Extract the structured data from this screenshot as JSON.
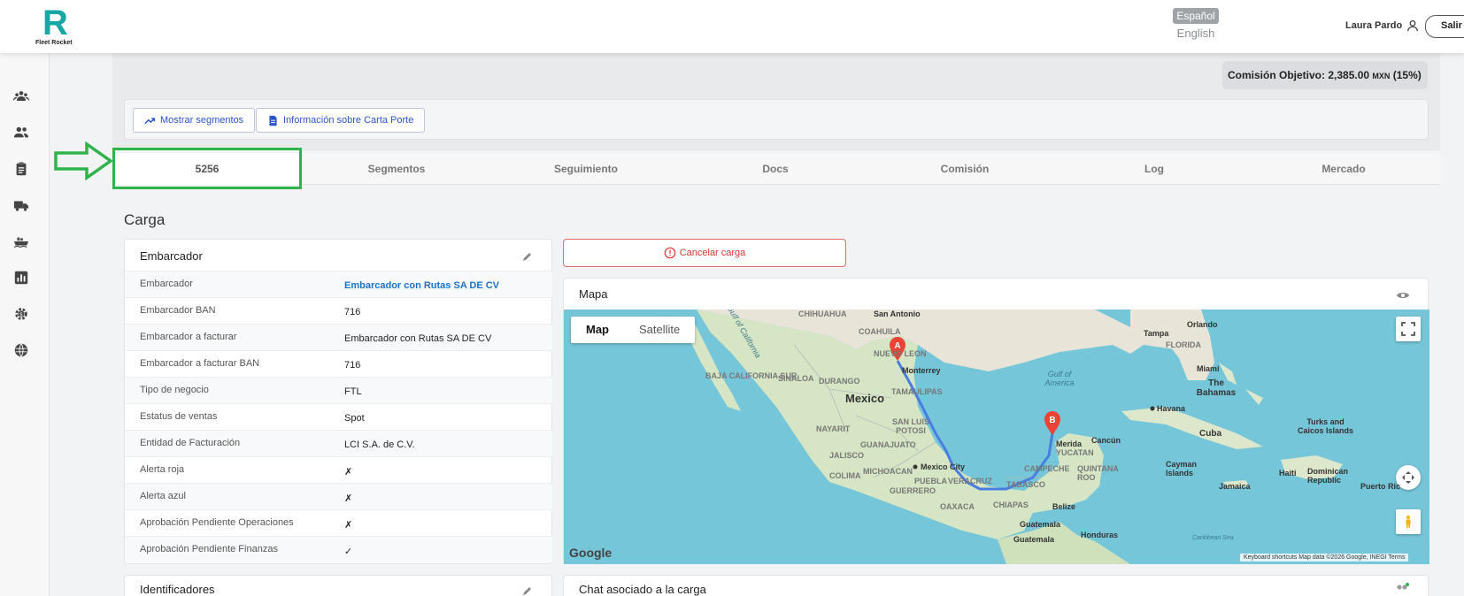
{
  "header": {
    "logo_text": "Fleet Rocket",
    "lang_active": "Español",
    "lang_other": "English",
    "user_name": "Laura Pardo",
    "logout_label": "Salir"
  },
  "sidebar": {
    "icons": [
      "groups-icon",
      "people-icon",
      "clipboard-icon",
      "truck-icon",
      "ship-icon",
      "chart-icon",
      "settings-money-icon",
      "globe-icon"
    ]
  },
  "summary": {
    "commission_label": "Comisión Objetivo: 2,385.00",
    "commission_currency": "MXN",
    "commission_pct": "(15%)"
  },
  "actions": {
    "show_segments": "Mostrar segmentos",
    "carta_porte": "Información sobre Carta Porte"
  },
  "tabs": [
    "5256",
    "Segmentos",
    "Seguimiento",
    "Docs",
    "Comisión",
    "Log",
    "Mercado"
  ],
  "section_title": "Carga",
  "shipper": {
    "title": "Embarcador",
    "rows": [
      {
        "label": "Embarcador",
        "value": "Embarcador con Rutas SA DE CV"
      },
      {
        "label": "Embarcador BAN",
        "value": "716"
      },
      {
        "label": "Embarcador a facturar",
        "value": "Embarcador con Rutas SA DE CV"
      },
      {
        "label": "Embarcador a facturar BAN",
        "value": "716"
      },
      {
        "label": "Tipo de negocio",
        "value": "FTL"
      },
      {
        "label": "Estatus de ventas",
        "value": "Spot"
      },
      {
        "label": "Entidad de Facturación",
        "value": "LCI S.A. de C.V."
      },
      {
        "label": "Alerta roja",
        "value": "✗"
      },
      {
        "label": "Alerta azul",
        "value": "✗"
      },
      {
        "label": "Aprobación Pendiente Operaciones",
        "value": "✗"
      },
      {
        "label": "Aprobación Pendiente Finanzas",
        "value": "✓"
      }
    ]
  },
  "cancel_label": "Cancelar carga",
  "map": {
    "title": "Mapa",
    "toggle_map": "Map",
    "toggle_satellite": "Satellite",
    "marker_a": "A",
    "marker_b": "B",
    "labels": {
      "mexico": "Mexico",
      "monterrey": "Monterrey",
      "merida": "Merida",
      "mexico_city": "Mexico City",
      "san_antonio": "San Antonio",
      "tampa": "Tampa",
      "orlando": "Orlando",
      "miami": "Miami",
      "bahamas": "The Bahamas",
      "havana": "Havana",
      "cuba": "Cuba",
      "turks": "Turks and Caicos Islands",
      "cayman": "Cayman Islands",
      "haiti": "Haiti",
      "dominican": "Dominican Republic",
      "jamaica": "Jamaica",
      "belize": "Belize",
      "guatemala": "Guatemala",
      "guatemala_city": "Guatemala",
      "honduras": "Honduras",
      "cancun": "Cancún",
      "gulf_mexico": "Gulf of America",
      "gulf_california": "Gulf of California",
      "puerto_rico": "Puerto Ric",
      "caribbean": "Caribbean Sea",
      "chihuahua": "CHIHUAHUA",
      "coahuila": "COAHUILA",
      "nuevo_leon": "NUEVO LEON",
      "baja": "BAJA CALIFORNIA SUR",
      "sinaloa": "SINALOA",
      "durango": "DURANGO",
      "tamaulipas": "TAMAULIPAS",
      "nayarit": "NAYARIT",
      "slp": "SAN LUIS POTOSI",
      "jalisco": "JALISCO",
      "guanajuato": "GUANAJUATO",
      "colima": "COLIMA",
      "michoacan": "MICHOACAN",
      "puebla": "PUEBLA",
      "veracruz": "VERACRUZ",
      "tabasco": "TABASCO",
      "campeche": "CAMPECHE",
      "yucatan": "YUCATAN",
      "quintana_roo": "QUINTANA ROO",
      "guerrero": "GUERRERO",
      "oaxaca": "OAXACA",
      "chiapas": "CHIAPAS",
      "florida": "FLORIDA"
    },
    "google": "Google",
    "footer": "Keyboard shortcuts   Map data ©2026 Google, INEGI   Terms"
  },
  "identifiers_title": "Identificadores",
  "chat_title": "Chat asociado a la carga",
  "colors": {
    "brand": "#19a7a6",
    "link": "#1a73c9",
    "danger": "#d33333",
    "annotation": "#2fb44b",
    "route": "#4a7de0"
  }
}
